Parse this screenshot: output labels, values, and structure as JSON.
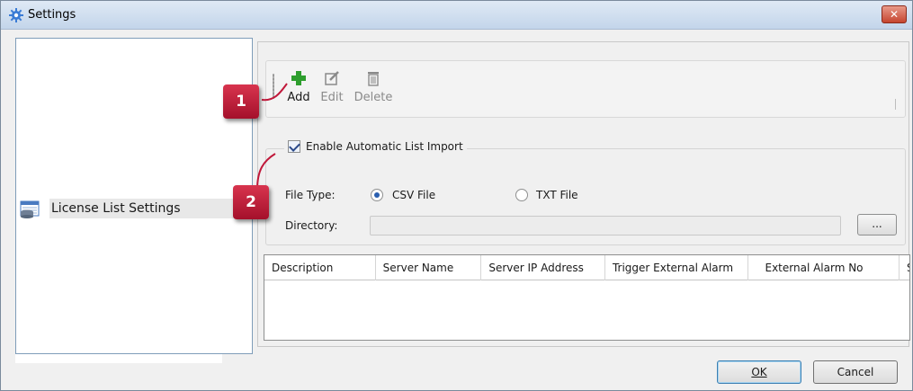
{
  "window": {
    "title": "Settings",
    "close_label": "✕"
  },
  "nav": {
    "items": [
      {
        "label": "License List Settings"
      }
    ]
  },
  "toolbar": {
    "add_label": "Add",
    "edit_label": "Edit",
    "delete_label": "Delete"
  },
  "import_group": {
    "enable_label": "Enable Automatic List Import",
    "enable_checked": true,
    "file_type_label": "File Type:",
    "options": [
      {
        "label": "CSV File",
        "selected": true
      },
      {
        "label": "TXT File",
        "selected": false
      }
    ],
    "directory_label": "Directory:",
    "directory_value": "",
    "browse_label": "..."
  },
  "grid": {
    "columns": [
      "Description",
      "Server Name",
      "Server IP Address",
      "Trigger External Alarm",
      "External Alarm No",
      "S"
    ],
    "rows": []
  },
  "footer": {
    "ok_label": "OK",
    "cancel_label": "Cancel"
  },
  "callouts": [
    "1",
    "2"
  ],
  "colors": {
    "accent": "#c0183a",
    "title_bar": "#c3d5ea",
    "add_icon": "#2e9e2e"
  }
}
